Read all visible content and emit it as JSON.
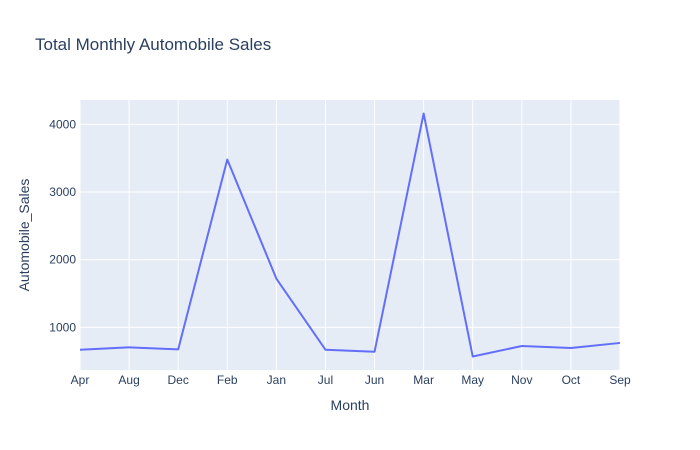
{
  "chart_data": {
    "type": "line",
    "title": "Total Monthly Automobile Sales",
    "xlabel": "Month",
    "ylabel": "Automobile_Sales",
    "categories": [
      "Apr",
      "Aug",
      "Dec",
      "Feb",
      "Jan",
      "Jul",
      "Jun",
      "Mar",
      "May",
      "Nov",
      "Oct",
      "Sep"
    ],
    "series": [
      {
        "values": [
          670,
          705,
          675,
          3480,
          1720,
          670,
          640,
          4160,
          570,
          725,
          695,
          770
        ],
        "color": "#636efa"
      }
    ],
    "ylim": [
      370,
      4360
    ],
    "yticks": [
      1000,
      2000,
      3000,
      4000
    ],
    "grid": true,
    "plot_bg": "#e5ecf6",
    "grid_color": "#ffffff",
    "text_color": "#2a3f5f"
  }
}
